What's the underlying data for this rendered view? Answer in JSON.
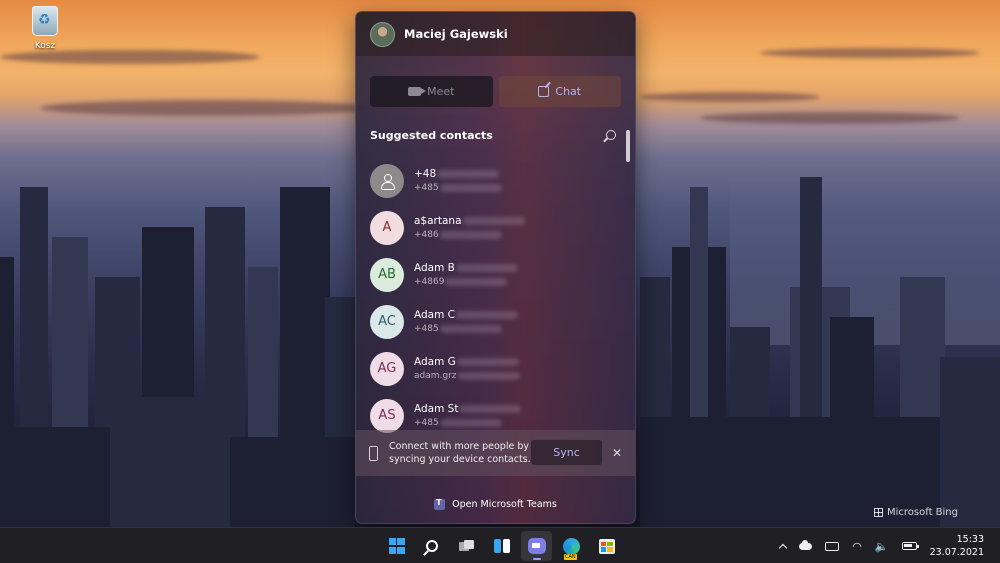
{
  "desktop": {
    "icons": [
      {
        "label": "Kosz",
        "icon": "recycle-bin-icon"
      }
    ],
    "watermark": "Microsoft Bing"
  },
  "flyout": {
    "user_name": "Maciej Gajewski",
    "segments": {
      "meet_label": "Meet",
      "chat_label": "Chat"
    },
    "suggested_title": "Suggested contacts",
    "contacts": [
      {
        "initials": "",
        "name": "+48",
        "sub": "+485",
        "avatar_color": "#8d8a8c",
        "avatar_text_color": "#ffffff",
        "generic": true
      },
      {
        "initials": "A",
        "name": "a$artana",
        "sub": "+486",
        "avatar_color": "#f1dcdf",
        "avatar_text_color": "#8b2a3a"
      },
      {
        "initials": "AB",
        "name": "Adam B",
        "sub": "+4869",
        "avatar_color": "#dcecdc",
        "avatar_text_color": "#2e6b34"
      },
      {
        "initials": "AC",
        "name": "Adam C",
        "sub": "+485",
        "avatar_color": "#dae8ea",
        "avatar_text_color": "#2f5f66"
      },
      {
        "initials": "AG",
        "name": "Adam G",
        "sub": "adam.grz",
        "avatar_color": "#efdce6",
        "avatar_text_color": "#7a2d55"
      },
      {
        "initials": "AS",
        "name": "Adam St",
        "sub": "+485",
        "avatar_color": "#efdce6",
        "avatar_text_color": "#7a2d55"
      }
    ],
    "sync": {
      "text": "Connect with more people by syncing your device contacts.",
      "button_label": "Sync",
      "close_glyph": "✕"
    },
    "open_teams_label": "Open Microsoft Teams"
  },
  "taskbar": {
    "apps": [
      {
        "name": "start",
        "icon": "windows-logo-icon"
      },
      {
        "name": "search",
        "icon": "search-icon"
      },
      {
        "name": "task-view",
        "icon": "task-view-icon"
      },
      {
        "name": "widgets",
        "icon": "widgets-icon"
      },
      {
        "name": "chat",
        "icon": "teams-chat-icon",
        "active": true
      },
      {
        "name": "edge-canary",
        "icon": "edge-canary-icon"
      },
      {
        "name": "store",
        "icon": "microsoft-store-icon"
      }
    ],
    "tray": {
      "wifi_glyph": "◠",
      "volume_glyph": "🔈",
      "time": "15:33",
      "date": "23.07.2021"
    }
  },
  "colors": {
    "accent": "#b5b3f4",
    "taskbar": "#202024"
  }
}
